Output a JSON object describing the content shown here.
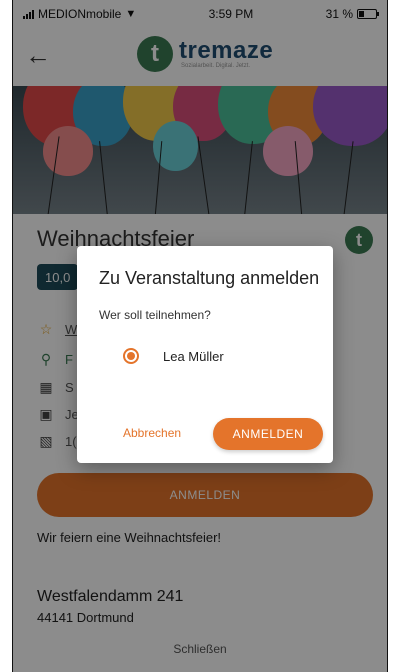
{
  "status_bar": {
    "carrier": "MEDIONmobile",
    "time": "3:59 PM",
    "battery": "31 %",
    "battery_level": 0.31
  },
  "header": {
    "logo_letter": "t",
    "logo_name": "tremaze",
    "logo_tagline": "Sozialarbeit. Digital. Jetzt."
  },
  "event": {
    "title": "Weihnachtsfeier",
    "price": "10,0",
    "rows": [
      {
        "icon": "star-icon",
        "text": "W"
      },
      {
        "icon": "location-icon",
        "text": "F"
      },
      {
        "icon": "calendar-icon",
        "text": "S"
      },
      {
        "icon": "person-icon",
        "text": "Je"
      },
      {
        "icon": "id-card-icon",
        "text": "1("
      }
    ],
    "register_button": "ANMELDEN",
    "description": "Wir feiern eine Weihnachtsfeier!",
    "street": "Westfalendamm 241",
    "city": "44141 Dortmund",
    "close_link": "Schließen"
  },
  "dialog": {
    "title": "Zu Veranstaltung anmelden",
    "subtitle": "Wer soll teilnehmen?",
    "option_label": "Lea Müller",
    "cancel_label": "Abbrechen",
    "confirm_label": "ANMELDEN"
  },
  "colors": {
    "accent": "#e4742b",
    "brand_green": "#3b7a52",
    "brand_blue": "#1f4d72",
    "price_bg": "#1e4c5a"
  }
}
